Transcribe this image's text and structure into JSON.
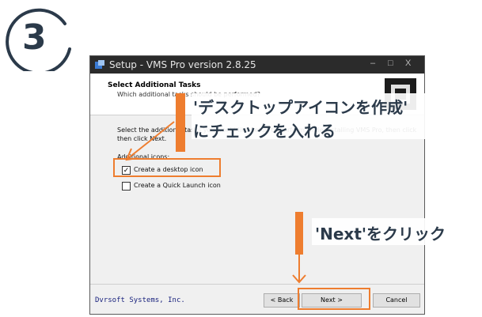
{
  "step": {
    "number": "3"
  },
  "window": {
    "title": "Setup - VMS Pro version 2.8.25",
    "controls": [
      "–",
      "□",
      "X"
    ],
    "header": {
      "title": "Select Additional Tasks",
      "subtitle": "Which additional tasks should be performed?"
    },
    "body": {
      "instruction_line1": "Select the additional tasks you would like Setup to perform while installing VMS Pro, then click Next.",
      "instruction_line2": "then click Next.",
      "additional_icons_label": "Additional icons:",
      "checkboxes": [
        {
          "label": "Create a desktop icon",
          "checked": true
        },
        {
          "label": "Create a Quick Launch icon",
          "checked": false
        }
      ]
    },
    "footer": {
      "company": "Dvrsoft Systems, Inc.",
      "back_label": "< Back",
      "next_label": "Next >",
      "cancel_label": "Cancel"
    }
  },
  "annotations": {
    "checkbox_callout_line1": "'デスクトップアイコンを作成'",
    "checkbox_callout_line2": "にチェックを入れる",
    "next_callout": "'Next'をクリック"
  },
  "colors": {
    "accent": "#ee7d2f",
    "text_dark": "#2b3a4a",
    "titlebar": "#2b2b2b"
  }
}
